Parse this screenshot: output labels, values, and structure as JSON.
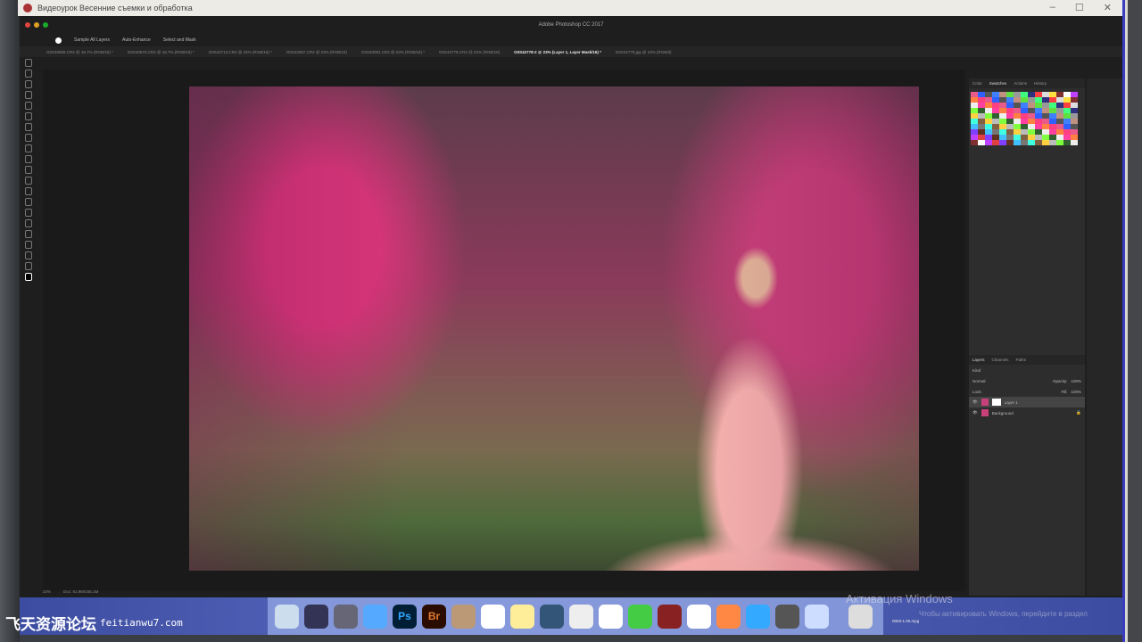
{
  "window": {
    "title": "Видеоурок Весенние съемки и обработка",
    "minimize": "–",
    "maximize": "☐",
    "close": "✕"
  },
  "photoshop": {
    "app_title": "Adobe Photoshop CC 2017",
    "options": [
      "Sample All Layers",
      "Auto-Enhance",
      "Select and Mask"
    ],
    "tabs": [
      "G0S40669.CR2 @ 16.7% (RGB/16) *",
      "G0S40670.CR2 @ 16.7% (RGB/16) *",
      "G0S42713.CR2 @ 23% (RGB/16) *",
      "G0S43087.CR2 @ 23% (RGB/16)",
      "G0S40091.CR2 @ 23% (RGB/16) *",
      "G0S42778.CR2 @ 23% (RGB/16)",
      "G0S42778-2 @ 23% (Layer 1, Layer Mask/16) *",
      "G0S42778.jpg @ 23% (RGB/8)"
    ],
    "active_tab": 6,
    "status": {
      "zoom": "23%",
      "doc": "Doc: 61.9M/165.1M"
    },
    "panels": {
      "top_tabs": [
        "Color",
        "Swatches",
        "Actions",
        "History"
      ],
      "active_top": 1,
      "layer_tabs": [
        "Layers",
        "Channels",
        "Paths"
      ],
      "kind": "Kind",
      "blend": "Normal",
      "opacity_label": "Opacity:",
      "opacity": "100%",
      "lock_label": "Lock:",
      "fill_label": "Fill:",
      "fill": "100%",
      "layers": [
        "Layer 1",
        "Background"
      ]
    }
  },
  "dock": {
    "apps": [
      "Finder",
      "Siri",
      "Launchpad",
      "Safari",
      "Ps",
      "Br",
      "Notes",
      "Calendar",
      "Stickies",
      "QuickTime",
      "Preview",
      "Photos",
      "Messages",
      "Photo Booth",
      "iTunes",
      "iBooks",
      "App Store",
      "System Preferences",
      "TeamViewer",
      "Trash"
    ],
    "file_label": "0003-1.00.mpg"
  },
  "overlay": {
    "activation": "Активация Windows",
    "activation_hint": "Чтобы активировать Windows, перейдите в раздел",
    "watermark": "飞天资源论坛",
    "watermark_url": "feitianwu7.com"
  }
}
